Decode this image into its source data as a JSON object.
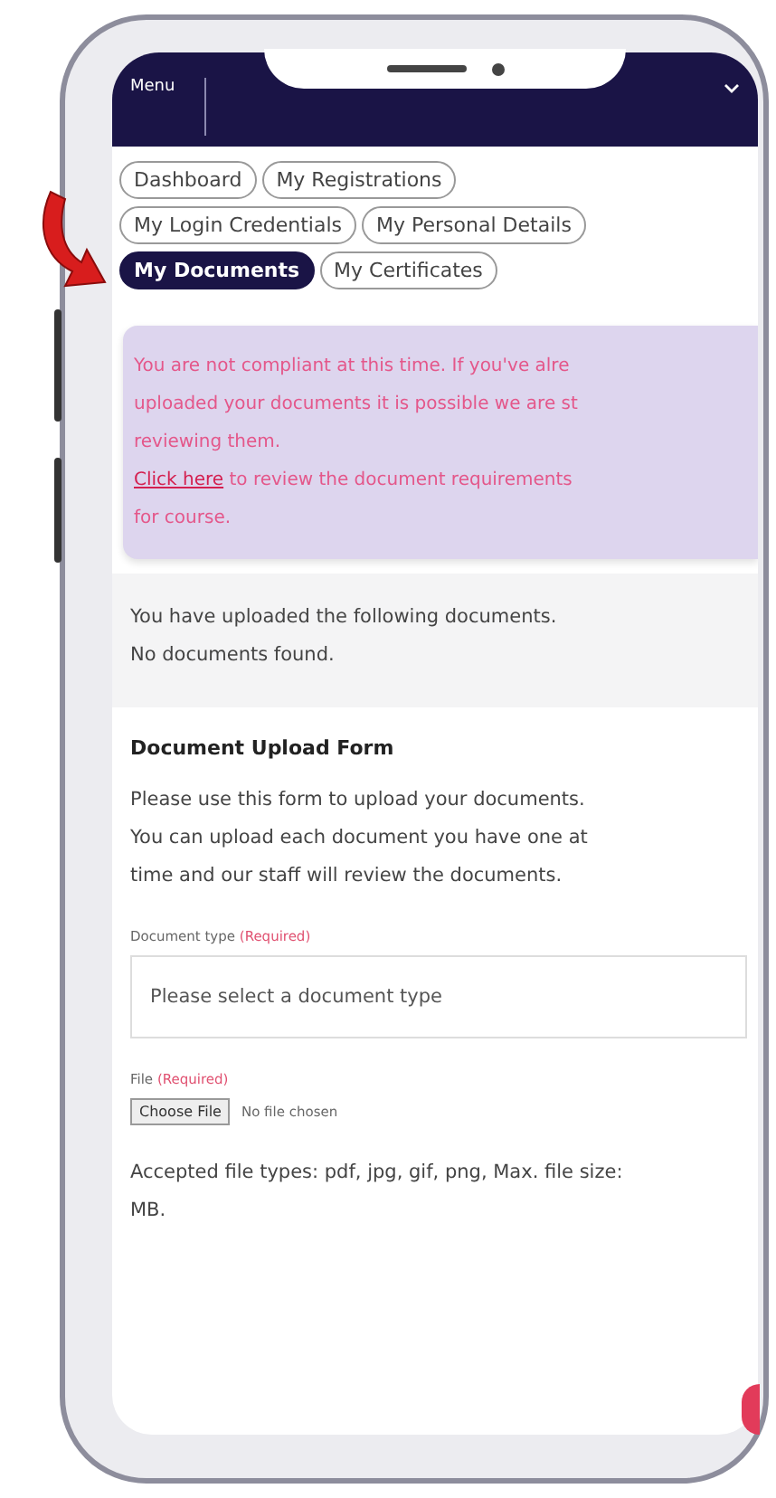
{
  "header": {
    "menu_label": "Menu"
  },
  "tabs": [
    {
      "label": "Dashboard",
      "selected": false
    },
    {
      "label": "My Registrations",
      "selected": false
    },
    {
      "label": "My Login Credentials",
      "selected": false
    },
    {
      "label": "My Personal Details",
      "selected": false
    },
    {
      "label": "My Documents",
      "selected": true
    },
    {
      "label": "My Certificates",
      "selected": false
    }
  ],
  "alert": {
    "lines": [
      "You are not compliant at this time. If you've alre",
      "uploaded your documents it is possible we are st",
      "reviewing them."
    ],
    "link": "Click here",
    "link_rest": "to review the document requirements",
    "last_line": "for course."
  },
  "uploaded": {
    "lines": [
      "You have uploaded the following documents.",
      "No documents found."
    ]
  },
  "form": {
    "title": "Document Upload Form",
    "intro_lines": [
      "Please use this form to upload your documents.",
      "You can upload each document you have one at",
      "time and our staff will review the documents."
    ],
    "fields": [
      {
        "kind": "select",
        "label": "Document type",
        "required": "(Required)",
        "placeholder": "Please select a document type"
      },
      {
        "kind": "file",
        "label": "File",
        "required": "(Required)",
        "button": "Choose File",
        "status": "No file chosen"
      }
    ],
    "accepted_lines": [
      "Accepted file types: pdf, jpg, gif, png, Max. file size:",
      "MB."
    ]
  }
}
